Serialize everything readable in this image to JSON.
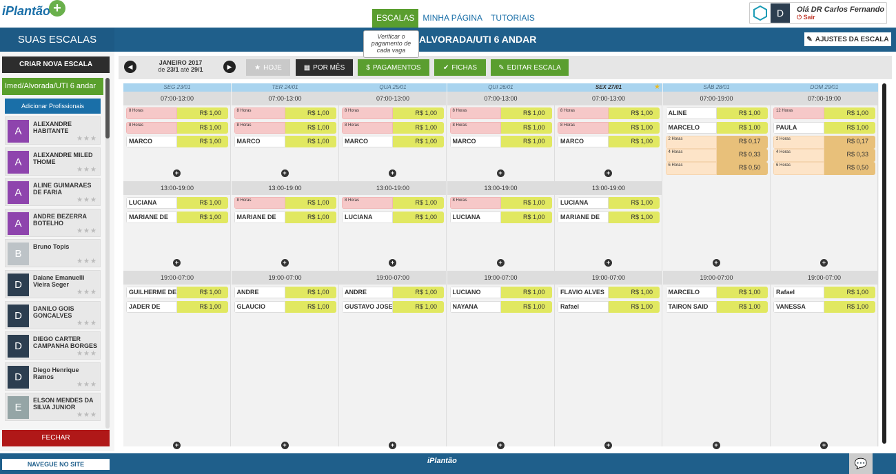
{
  "header": {
    "logo": "iPlantão",
    "nav": [
      "ESCALAS",
      "MINHA PÁGINA",
      "TUTORIAIS"
    ],
    "user_initial": "D",
    "user_greeting": "Olá DR Carlos Fernando",
    "logout": "Sair"
  },
  "bar": {
    "sidebar_title": "SUAS ESCALAS",
    "scale_title": "ALVORADA/UTI 6 ANDAR",
    "ajustes": "AJUSTES DA ESCALA",
    "tooltip": "Verificar o pagamento de cada vaga"
  },
  "sidebar": {
    "criar": "CRIAR NOVA ESCALA",
    "scale_item": "Imed/Alvorada/UTI 6 andar",
    "add_prof": "Adicionar Profissionais",
    "fechar": "FECHAR",
    "profs": [
      {
        "initial": "A",
        "name": "ALEXANDRE HABITANTE",
        "color": "#8e44ad"
      },
      {
        "initial": "A",
        "name": "ALEXANDRE MILED THOME",
        "color": "#8e44ad"
      },
      {
        "initial": "A",
        "name": "ALINE GUIMARAES DE FARIA",
        "color": "#8e44ad"
      },
      {
        "initial": "A",
        "name": "ANDRE BEZERRA BOTELHO",
        "color": "#8e44ad"
      },
      {
        "initial": "B",
        "name": "Bruno Topis",
        "color": "#bdc3c7"
      },
      {
        "initial": "D",
        "name": "Daiane Emanuelli Vieira Seger",
        "color": "#2c3e50"
      },
      {
        "initial": "D",
        "name": "DANILO GOIS GONCALVES",
        "color": "#2c3e50"
      },
      {
        "initial": "D",
        "name": "DIEGO CARTER CAMPANHA BORGES",
        "color": "#2c3e50"
      },
      {
        "initial": "D",
        "name": "Diego Henrique Ramos",
        "color": "#2c3e50"
      },
      {
        "initial": "E",
        "name": "ELSON MENDES DA SILVA JUNIOR",
        "color": "#95a5a6"
      }
    ]
  },
  "toolbar": {
    "month": "JANEIRO 2017",
    "range_pre": "de",
    "range_from": "23/1",
    "range_mid": "até",
    "range_to": "29/1",
    "hoje": "HOJE",
    "por_mes": "POR MÊS",
    "pagamentos": "PAGAMENTOS",
    "fichas": "FICHAS",
    "editar": "EDITAR ESCALA"
  },
  "calendar": {
    "days": [
      {
        "label": "SEG 23/01",
        "shifts": [
          {
            "time": "07:00-13:00",
            "slots": [
              [
                "pink",
                "8 Horas",
                "R$ 1,00"
              ],
              [
                "pink",
                "8 Horas",
                "R$ 1,00"
              ],
              [
                "n",
                "MARCO",
                "R$ 1,00"
              ]
            ]
          },
          {
            "time": "13:00-19:00",
            "slots": [
              [
                "n",
                "LUCIANA",
                "R$ 1,00"
              ],
              [
                "n",
                "MARIANE DE",
                "R$ 1,00"
              ]
            ]
          },
          {
            "time": "19:00-07:00",
            "slots": [
              [
                "n",
                "GUILHERME DE",
                "R$ 1,00"
              ],
              [
                "n",
                "JADER DE",
                "R$ 1,00"
              ]
            ]
          }
        ]
      },
      {
        "label": "TER 24/01",
        "shifts": [
          {
            "time": "07:00-13:00",
            "slots": [
              [
                "pink",
                "8 Horas",
                "R$ 1,00"
              ],
              [
                "pink",
                "8 Horas",
                "R$ 1,00"
              ],
              [
                "n",
                "MARCO",
                "R$ 1,00"
              ]
            ]
          },
          {
            "time": "13:00-19:00",
            "slots": [
              [
                "pink",
                "8 Horas",
                "R$ 1,00"
              ],
              [
                "n",
                "MARIANE DE",
                "R$ 1,00"
              ]
            ]
          },
          {
            "time": "19:00-07:00",
            "slots": [
              [
                "n",
                "ANDRE",
                "R$ 1,00"
              ],
              [
                "n",
                "GLAUCIO",
                "R$ 1,00"
              ]
            ]
          }
        ]
      },
      {
        "label": "QUA 25/01",
        "shifts": [
          {
            "time": "07:00-13:00",
            "slots": [
              [
                "pink",
                "8 Horas",
                "R$ 1,00"
              ],
              [
                "pink",
                "8 Horas",
                "R$ 1,00"
              ],
              [
                "n",
                "MARCO",
                "R$ 1,00"
              ]
            ]
          },
          {
            "time": "13:00-19:00",
            "slots": [
              [
                "pink",
                "8 Horas",
                "R$ 1,00"
              ],
              [
                "n",
                "LUCIANA",
                "R$ 1,00"
              ]
            ]
          },
          {
            "time": "19:00-07:00",
            "slots": [
              [
                "n",
                "ANDRE",
                "R$ 1,00"
              ],
              [
                "n",
                "GUSTAVO JOSE",
                "R$ 1,00"
              ]
            ]
          }
        ]
      },
      {
        "label": "QUI 26/01",
        "shifts": [
          {
            "time": "07:00-13:00",
            "slots": [
              [
                "pink",
                "8 Horas",
                "R$ 1,00"
              ],
              [
                "pink",
                "8 Horas",
                "R$ 1,00"
              ],
              [
                "n",
                "MARCO",
                "R$ 1,00"
              ]
            ]
          },
          {
            "time": "13:00-19:00",
            "slots": [
              [
                "pink",
                "8 Horas",
                "R$ 1,00"
              ],
              [
                "n",
                "LUCIANA",
                "R$ 1,00"
              ]
            ]
          },
          {
            "time": "19:00-07:00",
            "slots": [
              [
                "n",
                "LUCIANO",
                "R$ 1,00"
              ],
              [
                "n",
                "NAYANA",
                "R$ 1,00"
              ]
            ]
          }
        ]
      },
      {
        "label": "SEX 27/01",
        "today": true,
        "shifts": [
          {
            "time": "07:00-13:00",
            "slots": [
              [
                "pink",
                "8 Horas",
                "R$ 1,00"
              ],
              [
                "pink",
                "8 Horas",
                "R$ 1,00"
              ],
              [
                "n",
                "MARCO",
                "R$ 1,00"
              ]
            ]
          },
          {
            "time": "13:00-19:00",
            "slots": [
              [
                "n",
                "LUCIANA",
                "R$ 1,00"
              ],
              [
                "n",
                "MARIANE DE",
                "R$ 1,00"
              ]
            ]
          },
          {
            "time": "19:00-07:00",
            "slots": [
              [
                "n",
                "FLAVIO ALVES",
                "R$ 1,00"
              ],
              [
                "n",
                "Rafael",
                "R$ 1,00"
              ]
            ]
          }
        ]
      },
      {
        "label": "SÁB 28/01",
        "shifts": [
          {
            "time": "07:00-19:00",
            "slots": [
              [
                "n",
                "ALINE",
                "R$ 1,00"
              ],
              [
                "n",
                "MARCELO",
                "R$ 1,00"
              ],
              [
                "peach",
                "2 Horas",
                "R$ 0,17"
              ],
              [
                "peach",
                "4 Horas",
                "R$ 0,33"
              ],
              [
                "peach",
                "6 Horas",
                "R$ 0,50"
              ]
            ]
          },
          {
            "time": "19:00-07:00",
            "slots": [
              [
                "n",
                "MARCELO",
                "R$ 1,00"
              ],
              [
                "n",
                "TAIRON SAID",
                "R$ 1,00"
              ]
            ]
          }
        ]
      },
      {
        "label": "DOM 29/01",
        "shifts": [
          {
            "time": "07:00-19:00",
            "slots": [
              [
                "pink",
                "12 Horas",
                "R$ 1,00"
              ],
              [
                "n",
                "PAULA",
                "R$ 1,00"
              ],
              [
                "peach",
                "2 Horas",
                "R$ 0,17"
              ],
              [
                "peach",
                "4 Horas",
                "R$ 0,33"
              ],
              [
                "peach",
                "6 Horas",
                "R$ 0,50"
              ]
            ]
          },
          {
            "time": "19:00-07:00",
            "slots": [
              [
                "n",
                "Rafael",
                "R$ 1,00"
              ],
              [
                "n",
                "VANESSA",
                "R$ 1,00"
              ]
            ]
          }
        ]
      }
    ]
  },
  "footer": {
    "navegue": "NAVEGUE NO SITE",
    "logo": "iPlantão"
  },
  "colors": {
    "brand_blue": "#1f5f8b",
    "green": "#5a9e2f",
    "price_yellow": "#e1e861"
  }
}
